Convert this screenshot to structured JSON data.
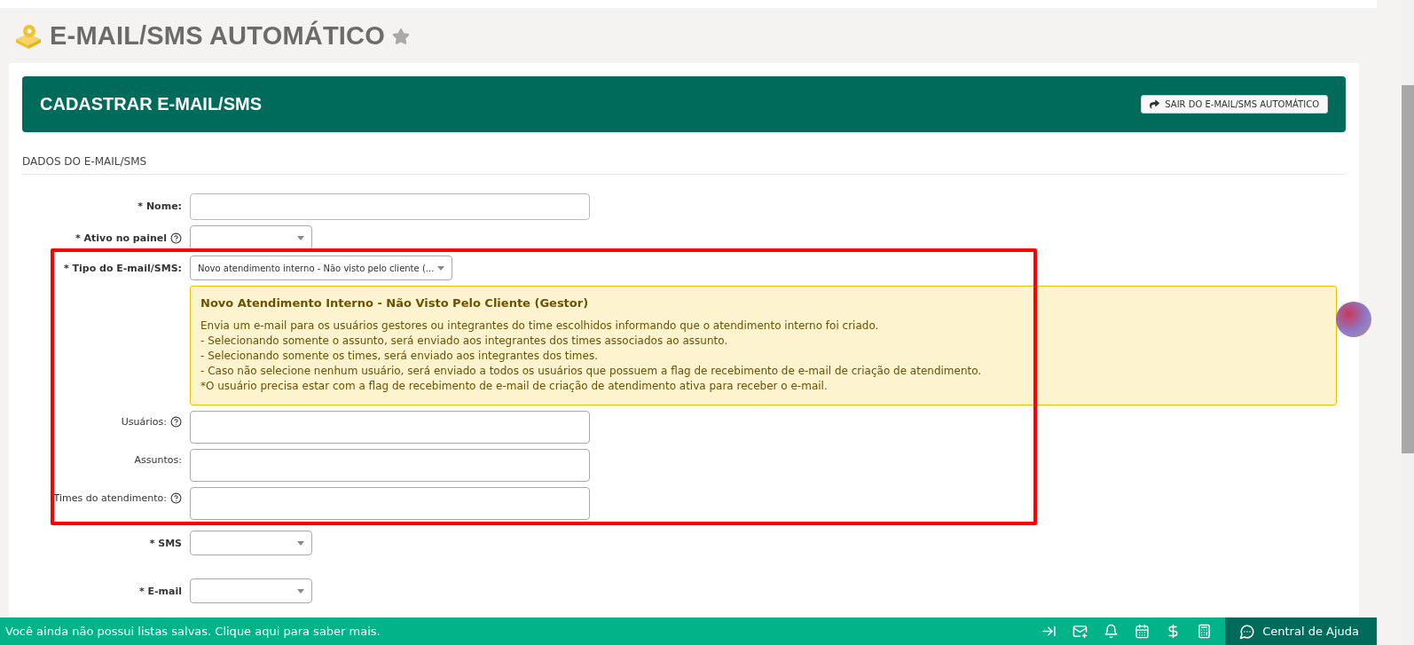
{
  "page": {
    "title": "E-MAIL/SMS AUTOMÁTICO",
    "favorite": false
  },
  "panel": {
    "title": "CADASTRAR E-MAIL/SMS",
    "exit_button": "SAIR DO E-MAIL/SMS AUTOMÁTICO"
  },
  "section": {
    "title": "DADOS DO E-MAIL/SMS"
  },
  "fields": [
    {
      "label": "* Nome:",
      "kind": "text",
      "required": true,
      "help": false
    },
    {
      "label": "* Ativo no painel",
      "kind": "select",
      "required": true,
      "help": true
    },
    {
      "label": "* Tipo do E-mail/SMS:",
      "kind": "select",
      "required": true,
      "help": false,
      "value": "Novo atendimento interno - Não visto pelo cliente (...",
      "info": {
        "title": "Novo Atendimento Interno - Não Visto Pelo Cliente (Gestor)",
        "lines": [
          "Envia um e-mail para os usuários gestores ou integrantes do time escolhidos informando que o atendimento interno foi criado.",
          "- Selecionando somente o assunto, será enviado aos integrantes dos times associados ao assunto.",
          "- Selecionando somente os times, será enviado aos integrantes dos times.",
          "- Caso não selecione nenhum usuário, será enviado a todos os usuários que possuem a flag de recebimento de e-mail de criação de atendimento.",
          "*O usuário precisa estar com a flag de recebimento de e-mail de criação de atendimento ativa para receber o e-mail."
        ]
      }
    },
    {
      "label": "Usuários:",
      "kind": "multi",
      "required": false,
      "help": true
    },
    {
      "label": "Assuntos:",
      "kind": "multi",
      "required": false,
      "help": false
    },
    {
      "label": "Times do atendimento:",
      "kind": "multi",
      "required": false,
      "help": true
    },
    {
      "label": "* SMS",
      "kind": "select",
      "required": true,
      "help": false
    },
    {
      "label": "* E-mail",
      "kind": "select",
      "required": true,
      "help": false
    }
  ],
  "footer": {
    "message": "Você ainda não possui listas salvas. Clique aqui para saber mais.",
    "help_button": "Central de Ajuda"
  }
}
